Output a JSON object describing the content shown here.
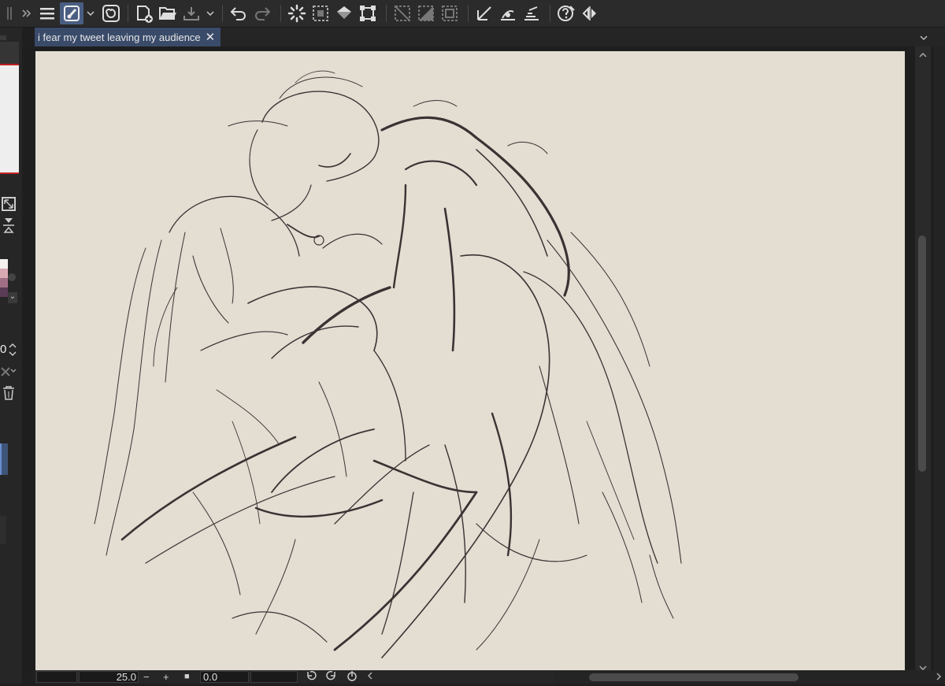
{
  "document": {
    "tab_title": "i fear my tweet leaving my audience",
    "close_glyph": "✕"
  },
  "toolbar": {
    "icons": [
      "grip-icon",
      "expand-chevrons-icon",
      "menu-icon",
      "brush-settings-icon",
      "dropdown-chevron-icon",
      "swirl-icon",
      "new-canvas-icon",
      "open-folder-icon",
      "export-icon",
      "undo-icon",
      "redo-icon",
      "loading-spinner-icon",
      "select-all-icon",
      "fill-icon",
      "transform-icon",
      "deselect-icon",
      "invert-selection-icon",
      "hide-selection-icon",
      "ruler-icon",
      "snap-icon",
      "special-ruler-icon",
      "help-icon",
      "flip-icon"
    ]
  },
  "status": {
    "zoom": "25.0",
    "zoom_minus": "−",
    "zoom_plus": "+",
    "rotation": "0.0",
    "fit_glyph": "■"
  },
  "left_panel": {
    "value_fragment": "0"
  },
  "colors": {
    "canvas": "#e3ddd2",
    "ui_dark": "#2b2b2b",
    "accent_tab": "#3a4b6a",
    "sketch_ink": "#3b3233"
  }
}
